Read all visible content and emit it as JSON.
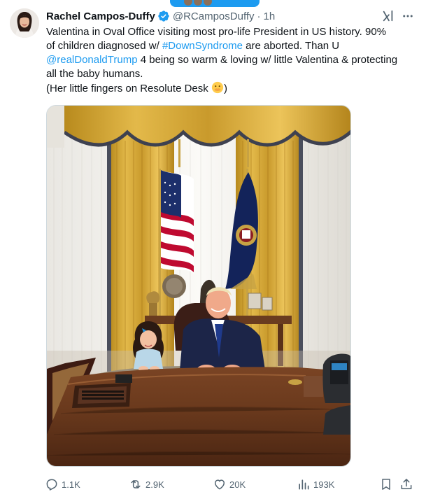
{
  "tweet": {
    "display_name": "Rachel Campos-Duffy",
    "handle": "@RCamposDuffy",
    "separator": "·",
    "time": "1h",
    "text_lines": [
      [
        {
          "t": "Valentina in Oval Office visiting most pro-life President in US history. 90%"
        }
      ],
      [
        {
          "t": "of children diagnosed w/ "
        },
        {
          "t": "#DownSyndrome",
          "link": true
        },
        {
          "t": " are aborted. Than U"
        }
      ],
      [
        {
          "t": "@realDonaldTrump",
          "link": true
        },
        {
          "t": " 4 being so warm & loving w/ little Valentina & protecting"
        }
      ],
      [
        {
          "t": "all the baby humans."
        }
      ],
      [
        {
          "t": "(Her little fingers on Resolute Desk "
        },
        {
          "emoji": "hand-over-mouth-emoji"
        },
        {
          "t": ")"
        }
      ]
    ]
  },
  "icons": {
    "verified": "verified-badge-icon",
    "grok": "grok-icon",
    "more": "more-icon",
    "reply": "reply-icon",
    "retweet": "retweet-icon",
    "like": "like-icon",
    "views": "views-icon",
    "bookmark": "bookmark-icon",
    "share": "share-icon"
  },
  "actions": {
    "replies": "1.1K",
    "retweets": "2.9K",
    "likes": "20K",
    "views": "193K"
  },
  "colors": {
    "accent": "#1d9bf0",
    "text": "#0f1419",
    "muted": "#536471",
    "border": "#cfd9de"
  }
}
